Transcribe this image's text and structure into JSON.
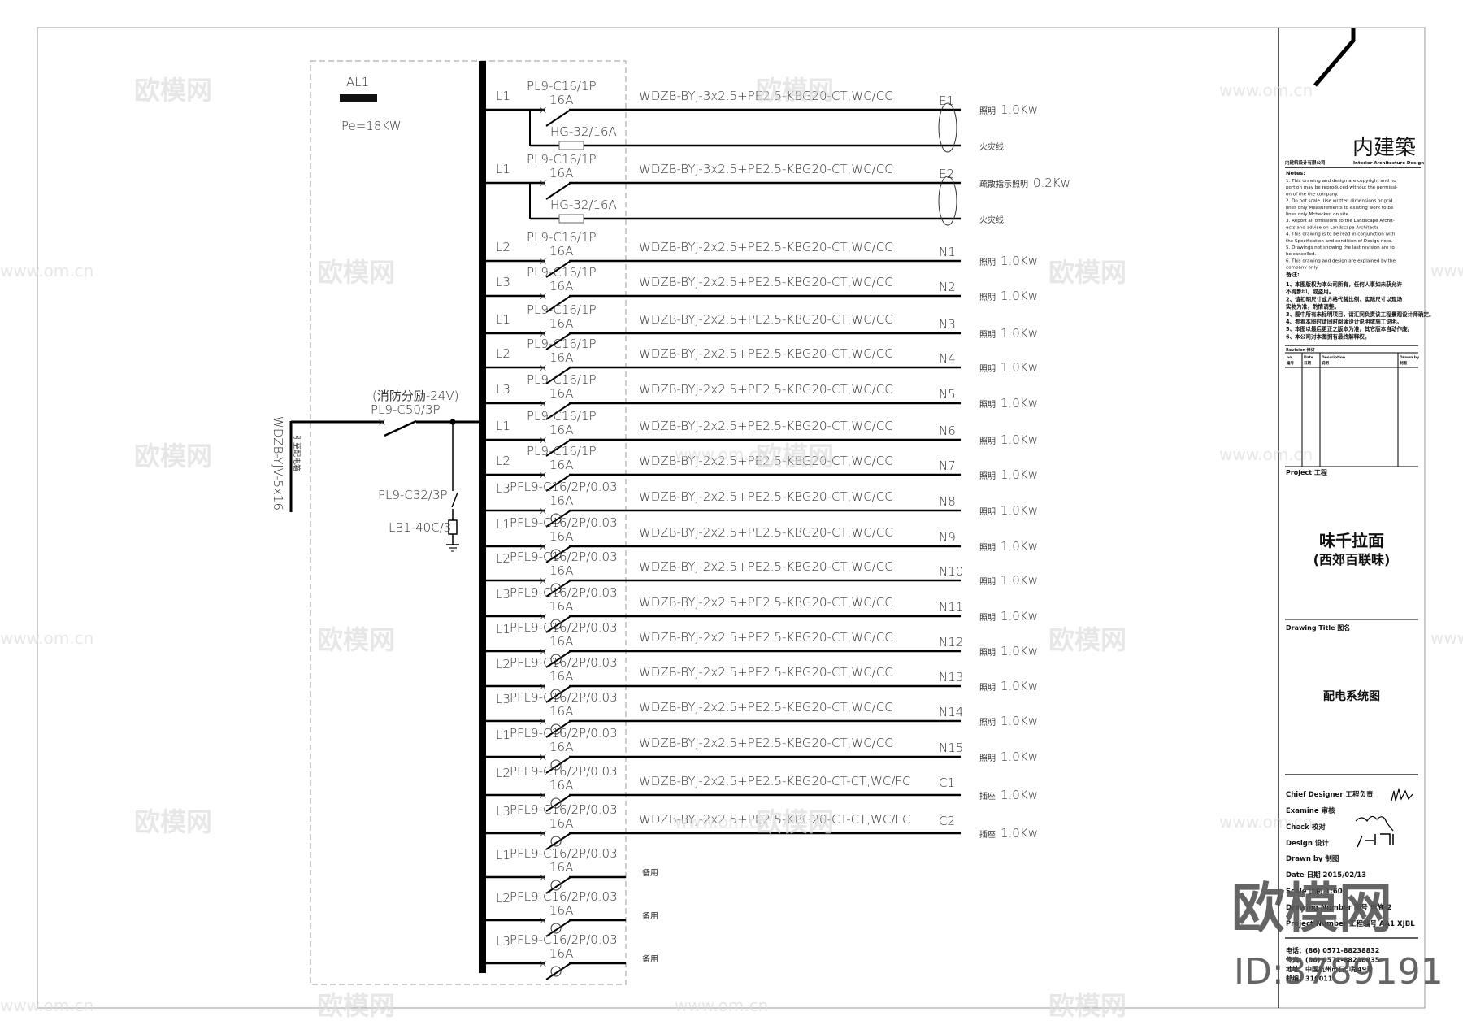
{
  "panel": {
    "name": "AL1",
    "power": "Pe=18KW"
  },
  "incoming": {
    "cable": "WDZB-YJV-5x16",
    "source_note": "引至配电箱",
    "main_breaker": "PL9-C50/3P",
    "main_note": "(消防分励-24V)",
    "spd_breaker": "PL9-C32/3P",
    "spd": "LB1-40C/3"
  },
  "circuits": [
    {
      "phase": "L1",
      "breaker": "PL9-C16/1P",
      "rating": "16A",
      "cable": "WDZB-BYJ-3x2.5+PE2.5-KBG20-CT,WC/CC",
      "id": "E1",
      "load": "照明",
      "power": "1.0Kw",
      "fire_fuse": "HG-32/16A",
      "fire_label": "火灾线"
    },
    {
      "phase": "L1",
      "breaker": "PL9-C16/1P",
      "rating": "16A",
      "cable": "WDZB-BYJ-3x2.5+PE2.5-KBG20-CT,WC/CC",
      "id": "E2",
      "load": "疏散指示照明",
      "power": "0.2Kw",
      "fire_fuse": "HG-32/16A",
      "fire_label": "火灾线"
    },
    {
      "phase": "L2",
      "breaker": "PL9-C16/1P",
      "rating": "16A",
      "cable": "WDZB-BYJ-2x2.5+PE2.5-KBG20-CT,WC/CC",
      "id": "N1",
      "load": "照明",
      "power": "1.0Kw"
    },
    {
      "phase": "L3",
      "breaker": "PL9-C16/1P",
      "rating": "16A",
      "cable": "WDZB-BYJ-2x2.5+PE2.5-KBG20-CT,WC/CC",
      "id": "N2",
      "load": "照明",
      "power": "1.0Kw"
    },
    {
      "phase": "L1",
      "breaker": "PL9-C16/1P",
      "rating": "16A",
      "cable": "WDZB-BYJ-2x2.5+PE2.5-KBG20-CT,WC/CC",
      "id": "N3",
      "load": "照明",
      "power": "1.0Kw"
    },
    {
      "phase": "L2",
      "breaker": "PL9-C16/1P",
      "rating": "16A",
      "cable": "WDZB-BYJ-2x2.5+PE2.5-KBG20-CT,WC/CC",
      "id": "N4",
      "load": "照明",
      "power": "1.0Kw"
    },
    {
      "phase": "L3",
      "breaker": "PL9-C16/1P",
      "rating": "16A",
      "cable": "WDZB-BYJ-2x2.5+PE2.5-KBG20-CT,WC/CC",
      "id": "N5",
      "load": "照明",
      "power": "1.0Kw"
    },
    {
      "phase": "L1",
      "breaker": "PL9-C16/1P",
      "rating": "16A",
      "cable": "WDZB-BYJ-2x2.5+PE2.5-KBG20-CT,WC/CC",
      "id": "N6",
      "load": "照明",
      "power": "1.0Kw"
    },
    {
      "phase": "L2",
      "breaker": "PL9-C16/1P",
      "rating": "16A",
      "cable": "WDZB-BYJ-2x2.5+PE2.5-KBG20-CT,WC/CC",
      "id": "N7",
      "load": "照明",
      "power": "1.0Kw"
    },
    {
      "phase": "L3",
      "breaker": "PFL9-C16/2P/0.03",
      "rating": "16A",
      "cable": "WDZB-BYJ-2x2.5+PE2.5-KBG20-CT,WC/CC",
      "id": "N8",
      "load": "照明",
      "power": "1.0Kw"
    },
    {
      "phase": "L1",
      "breaker": "PFL9-C16/2P/0.03",
      "rating": "16A",
      "cable": "WDZB-BYJ-2x2.5+PE2.5-KBG20-CT,WC/CC",
      "id": "N9",
      "load": "照明",
      "power": "1.0Kw"
    },
    {
      "phase": "L2",
      "breaker": "PFL9-C16/2P/0.03",
      "rating": "16A",
      "cable": "WDZB-BYJ-2x2.5+PE2.5-KBG20-CT,WC/CC",
      "id": "N10",
      "load": "照明",
      "power": "1.0Kw"
    },
    {
      "phase": "L3",
      "breaker": "PFL9-C16/2P/0.03",
      "rating": "16A",
      "cable": "WDZB-BYJ-2x2.5+PE2.5-KBG20-CT,WC/CC",
      "id": "N11",
      "load": "照明",
      "power": "1.0Kw"
    },
    {
      "phase": "L1",
      "breaker": "PFL9-C16/2P/0.03",
      "rating": "16A",
      "cable": "WDZB-BYJ-2x2.5+PE2.5-KBG20-CT,WC/CC",
      "id": "N12",
      "load": "照明",
      "power": "1.0Kw"
    },
    {
      "phase": "L2",
      "breaker": "PFL9-C16/2P/0.03",
      "rating": "16A",
      "cable": "WDZB-BYJ-2x2.5+PE2.5-KBG20-CT,WC/CC",
      "id": "N13",
      "load": "照明",
      "power": "1.0Kw"
    },
    {
      "phase": "L3",
      "breaker": "PFL9-C16/2P/0.03",
      "rating": "16A",
      "cable": "WDZB-BYJ-2x2.5+PE2.5-KBG20-CT,WC/CC",
      "id": "N14",
      "load": "照明",
      "power": "1.0Kw"
    },
    {
      "phase": "L1",
      "breaker": "PFL9-C16/2P/0.03",
      "rating": "16A",
      "cable": "WDZB-BYJ-2x2.5+PE2.5-KBG20-CT,WC/CC",
      "id": "N15",
      "load": "照明",
      "power": "1.0Kw"
    },
    {
      "phase": "L2",
      "breaker": "PFL9-C16/2P/0.03",
      "rating": "16A",
      "cable": "WDZB-BYJ-2x2.5+PE2.5-KBG20-CT-CT,WC/FC",
      "id": "C1",
      "load": "插座",
      "power": "1.0Kw"
    },
    {
      "phase": "L3",
      "breaker": "PFL9-C16/2P/0.03",
      "rating": "16A",
      "cable": "WDZB-BYJ-2x2.5+PE2.5-KBG20-CT-CT,WC/FC",
      "id": "C2",
      "load": "插座",
      "power": "1.0Kw"
    },
    {
      "phase": "L1",
      "breaker": "PFL9-C16/2P/0.03",
      "rating": "16A",
      "spare": "备用"
    },
    {
      "phase": "L2",
      "breaker": "PFL9-C16/2P/0.03",
      "rating": "16A",
      "spare": "备用"
    },
    {
      "phase": "L3",
      "breaker": "PFL9-C16/2P/0.03",
      "rating": "16A",
      "spare": "备用"
    }
  ],
  "title_block": {
    "logo": "内建築",
    "company": "内建筑设计有限公司",
    "company_en": "Interior Architecture Design",
    "notes_title": "Notes:",
    "notes": [
      "1. This drawing and design are copyright and no",
      "portion may be reproduced without the permissi-",
      "on of the the company.",
      "2. Do not scale. Use written dimensions or grid",
      "lines only Measurements to existing work to be",
      "lines only Mchecked on site.",
      "3. Report all omissions to the Landscape Archit-",
      "ects and advise on Landscape Architects",
      "4. This drawing is to be read in conjunction with",
      "the Specification and condition of Design note.",
      "5. Drawings not showing the last revision are to",
      "be cancelled.",
      "6. This drawing and design are explained by the",
      "company only."
    ],
    "notes_cn_title": "备注:",
    "notes_cn": [
      "1、本图版权为本公司所有，任何人事如未获允许",
      "不得影印，或盗用。",
      "2、请扣明尺寸或方格代替比例，实际尺寸以现场",
      "实物为准，酌情调整。",
      "3、图中所有未标明项目，请汇同负责该工程景观设计师确定。",
      "4、参看本图时请同时阅读设计说明或施工说明。",
      "5、本图以最后更正之版本为准，其它版本自动作废。",
      "6、本公司对本图拥有最终解释权。"
    ],
    "revision_label": "Revision 修订",
    "revision_headers": [
      [
        "no.",
        "编号"
      ],
      [
        "Date",
        "日期"
      ],
      [
        "Description",
        "说明"
      ],
      [
        "Drawn by",
        "制图"
      ]
    ],
    "project_label": "Project  工程",
    "project_name": "味千拉面",
    "project_sub": "(西郊百联味)",
    "drawing_title_label": "Drawing Title 图名",
    "drawing_title": "配电系统图",
    "fields": [
      "Chief Designer 工程负责",
      "Examine 审核",
      "Check 校对",
      "Design 设计",
      "Drawn by 制图",
      "Date 日期     2015/02/13",
      "Scale 比例    1:60",
      "Drawing Number 图号 电施-2",
      "Project Number 工程编号 AA1 XJBL"
    ],
    "contact": [
      "电话：(86) 0571-88238832",
      "传真：(86) 0571-88238835",
      "地址：中国杭州市石印路49号",
      "邮编：310011"
    ]
  },
  "watermark": {
    "text": "欧模网",
    "url": "www.om.cn",
    "id": "ID:3789191"
  }
}
